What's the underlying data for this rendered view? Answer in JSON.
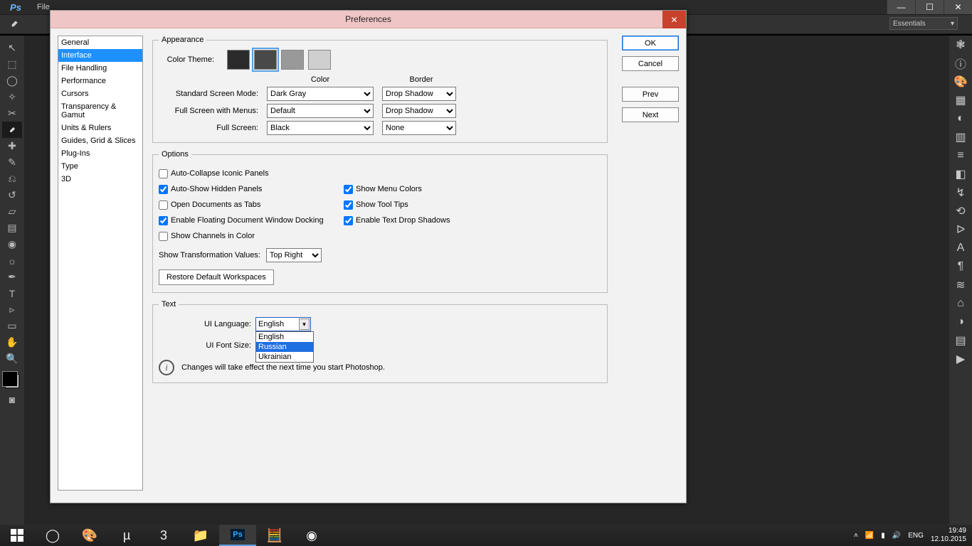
{
  "menubar": {
    "items": [
      "File"
    ]
  },
  "workspace_selector": "Essentials",
  "dialog": {
    "title": "Preferences",
    "buttons": {
      "ok": "OK",
      "cancel": "Cancel",
      "prev": "Prev",
      "next": "Next"
    },
    "sidebar": [
      "General",
      "Interface",
      "File Handling",
      "Performance",
      "Cursors",
      "Transparency & Gamut",
      "Units & Rulers",
      "Guides, Grid & Slices",
      "Plug-Ins",
      "Type",
      "3D"
    ],
    "sidebar_selected": "Interface",
    "appearance": {
      "legend": "Appearance",
      "color_theme_label": "Color Theme:",
      "theme_colors": [
        "#2b2b2b",
        "#494949",
        "#999999",
        "#cfcfcf"
      ],
      "theme_selected_index": 1,
      "col_color": "Color",
      "col_border": "Border",
      "rows": [
        {
          "label": "Standard Screen Mode:",
          "color": "Dark Gray",
          "border": "Drop Shadow"
        },
        {
          "label": "Full Screen with Menus:",
          "color": "Default",
          "border": "Drop Shadow"
        },
        {
          "label": "Full Screen:",
          "color": "Black",
          "border": "None"
        }
      ]
    },
    "options": {
      "legend": "Options",
      "auto_collapse": {
        "label": "Auto-Collapse Iconic Panels",
        "checked": false
      },
      "auto_show": {
        "label": "Auto-Show Hidden Panels",
        "checked": true
      },
      "open_tabs": {
        "label": "Open Documents as Tabs",
        "checked": false
      },
      "enable_docking": {
        "label": "Enable Floating Document Window Docking",
        "checked": true
      },
      "show_channels": {
        "label": "Show Channels in Color",
        "checked": false
      },
      "show_menu_colors": {
        "label": "Show Menu Colors",
        "checked": true
      },
      "show_tooltips": {
        "label": "Show Tool Tips",
        "checked": true
      },
      "enable_text_shadow": {
        "label": "Enable Text Drop Shadows",
        "checked": true
      },
      "transformation_label": "Show Transformation Values:",
      "transformation_value": "Top Right",
      "restore_btn": "Restore Default Workspaces"
    },
    "text": {
      "legend": "Text",
      "ui_language_label": "UI Language:",
      "ui_language_value": "English",
      "ui_language_options": [
        "English",
        "Russian",
        "Ukrainian"
      ],
      "ui_language_highlighted": "Russian",
      "ui_font_size_label": "UI Font Size:",
      "info": "Changes will take effect the next time you start Photoshop."
    }
  },
  "taskbar": {
    "lang": "ENG",
    "time": "19:49",
    "date": "12.10.2015"
  }
}
